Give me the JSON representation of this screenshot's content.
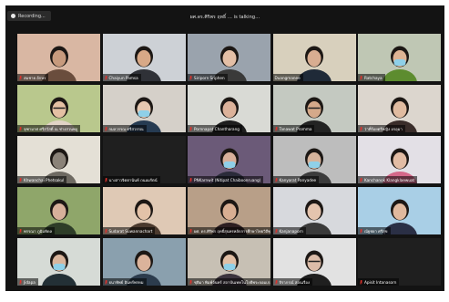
{
  "meeting": {
    "recording_label": "Recording...",
    "active_speaker_text": "ผศ.ดร.ศิริพร ฤทธิ์ ... is talking..."
  },
  "colors": {
    "window_bg": "#131313",
    "muted_mic": "#e0322c"
  },
  "participants": [
    {
      "name": "สมชาย อักษร",
      "bg": "#d9b7a3",
      "person": "#6a4d3d",
      "skin": "#c79a7d",
      "face": "plain",
      "muted": true
    },
    {
      "name": "Chaiyun Pamsa",
      "bg": "#cdd1d6",
      "person": "#2f3137",
      "skin": "#d8a987",
      "face": "plain",
      "muted": true
    },
    {
      "name": "Siriporn Sriphen",
      "bg": "#9aa3ad",
      "person": "#3a3a3a",
      "skin": "#e3bfa6",
      "face": "plain",
      "muted": true
    },
    {
      "name": "Duangmanee",
      "bg": "#d8d0bd",
      "person": "#1f2a38",
      "skin": "#d8ad91",
      "face": "plain",
      "muted": false
    },
    {
      "name": "Ratchaya",
      "bg": "#bfc7b4",
      "person": "#5d8c2f",
      "skin": "#ddb494",
      "face": "mask",
      "muted": true
    },
    {
      "name": "จุฑามาศ ศรีสวัสดิ์ ณ ช่างสวนพลู",
      "bg": "#b9c88d",
      "person": "#e1d3c6",
      "skin": "#e4c0a3",
      "face": "glasses",
      "muted": true
    },
    {
      "name": "กมลวรรณ ศรีสวรรณ",
      "bg": "#d5d0c9",
      "person": "#263b52",
      "skin": "#e6c8b1",
      "face": "mask",
      "muted": true
    },
    {
      "name": "Pornnapat Chantharang",
      "bg": "#d9dad5",
      "person": "#1e1e1e",
      "skin": "#dcb29a",
      "face": "plain",
      "muted": true
    },
    {
      "name": "Tanawat Promma",
      "bg": "#c4c9c1",
      "person": "#232323",
      "skin": "#d5a98a",
      "face": "glasses",
      "muted": true
    },
    {
      "name": "ว่าที่ร้อยตรีหญิง อรอุมา",
      "bg": "#dcd6ce",
      "person": "#3a2d2a",
      "skin": "#e0bba0",
      "face": "plain",
      "muted": true
    },
    {
      "name": "Khwanchai Phetsakul",
      "bg": "#e4e0d6",
      "person": "#6e6a62",
      "skin": "#8a8278",
      "face": "plain",
      "muted": true
    },
    {
      "name": "นางสาวจิตตานันท์ ถนอมรัตน์",
      "bg": "#1f1f1f",
      "person": "#1f1f1f",
      "skin": "#1f1f1f",
      "face": "none",
      "muted": true
    },
    {
      "name": "PNKarnwit (Nitipat Chaiboonruang)",
      "bg": "#6b5a78",
      "person": "#2b2b3a",
      "skin": "#d8b09a",
      "face": "mask",
      "muted": true
    },
    {
      "name": "Kanyarat Panyadee",
      "bg": "#bdbdbd",
      "person": "#3b3b3b",
      "skin": "#d6b39b",
      "face": "mask",
      "muted": true
    },
    {
      "name": "Kanchanok Klangklaewuat",
      "bg": "#e3e0e6",
      "person": "#d5688a",
      "skin": "#e2bca4",
      "face": "plain",
      "muted": true
    },
    {
      "name": "พรรณา ภูมิมหิดล",
      "bg": "#8fa66a",
      "person": "#2e3d28",
      "skin": "#d7b09a",
      "face": "plain",
      "muted": true
    },
    {
      "name": "Sudarat Suwannachart",
      "bg": "#dfc9b5",
      "person": "#4b3a2e",
      "skin": "#e3c2a8",
      "face": "plain",
      "muted": true
    },
    {
      "name": "ผศ. ดร.ศิริพร ฤทธิ์สุนทรหลักการศึกษาไทยวิถีพุทธ",
      "bg": "#b89f88",
      "person": "#2d1f22",
      "skin": "#d8ae92",
      "face": "plain",
      "muted": true
    },
    {
      "name": "Kanjanaporn",
      "bg": "#d7d9dd",
      "person": "#3a3a3a",
      "skin": "#e4c4ae",
      "face": "plain",
      "muted": true
    },
    {
      "name": "ณัฐชยา ศรีสุข",
      "bg": "#a9cfe6",
      "person": "#2a2f45",
      "skin": "#e0b99e",
      "face": "plain",
      "muted": true
    },
    {
      "name": "Jidapa",
      "bg": "#d6dbd6",
      "person": "#233036",
      "skin": "#d9b59c",
      "face": "mask",
      "muted": true
    },
    {
      "name": "ธนาทิพย์ อินทร์พรหม",
      "bg": "#8aa0ae",
      "person": "#2c3c4d",
      "skin": "#dbb39b",
      "face": "plain",
      "muted": true
    },
    {
      "name": "ชุติมา พิมพ์จันทร์ สถาบันเทคโนโลยีพระจอมเกล้า",
      "bg": "#c7c0b4",
      "person": "#3c343d",
      "skin": "#e1bfa5",
      "face": "mask",
      "muted": true
    },
    {
      "name": "จิราภรณ์ สอนเรือง",
      "bg": "#e2e2e2",
      "person": "#1f1f1f",
      "skin": "#dcbca8",
      "face": "glasses",
      "muted": true
    },
    {
      "name": "Apisit Intanasorn",
      "bg": "#1f1f1f",
      "person": "#1f1f1f",
      "skin": "#1f1f1f",
      "face": "none",
      "muted": true
    }
  ]
}
